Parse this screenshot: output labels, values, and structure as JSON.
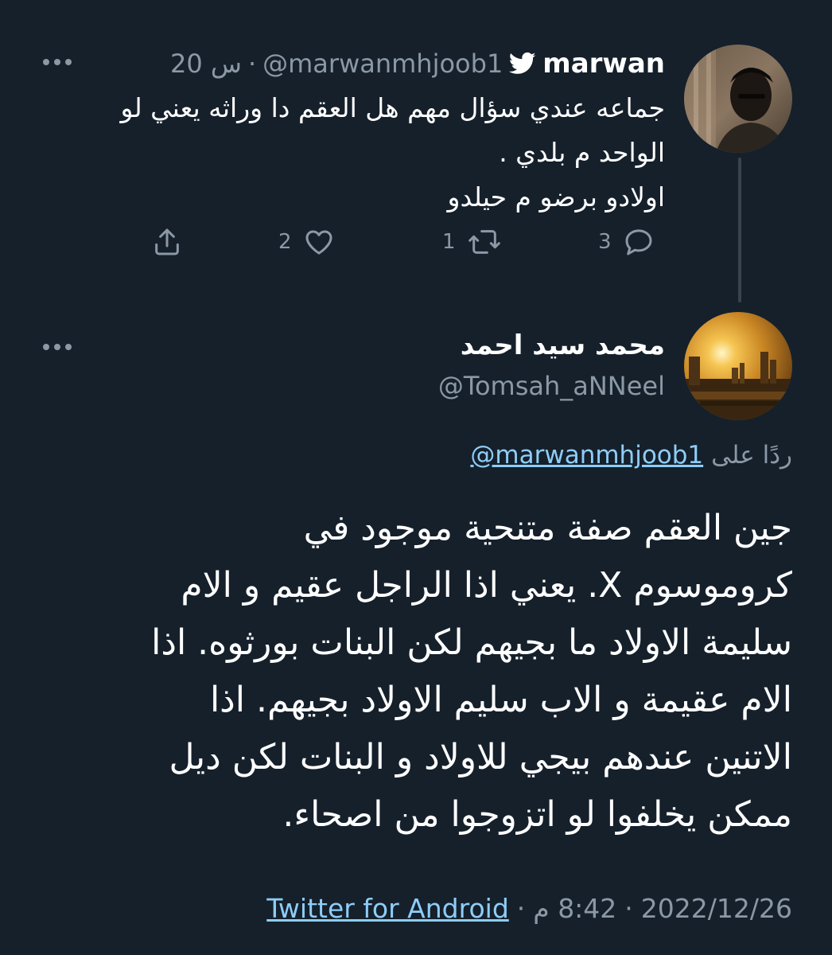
{
  "parent_tweet": {
    "display_name": "marwan",
    "handle": "@marwanmhjoob1",
    "separator": "·",
    "time_ago": "20 س",
    "text_lines": [
      "جماعه عندي سؤال مهم  هل العقم دا وراثه يعني لو",
      "الواحد م بلدي .",
      "اولادو برضو م حيلدو"
    ],
    "actions": {
      "reply_count": "3",
      "retweet_count": "1",
      "like_count": "2"
    }
  },
  "reply_tweet": {
    "display_name": "محمد سيد احمد",
    "handle": "@Tomsah_aNNeel",
    "replying_to_label": "ردًا على",
    "replying_to_handle": "@marwanmhjoob1",
    "text_lines": [
      "جين العقم صفة متنحية  موجود في",
      "كروموسوم  X. يعني اذا الراجل عقيم و الام",
      "سليمة الاولاد ما بجيهم لكن البنات بورثوه. اذا",
      "الام عقيمة و الاب سليم الاولاد بجيهم. اذا",
      "الاتنين عندهم بيجي للاولاد و البنات لكن ديل",
      "ممكن يخلفوا لو اتزوجوا من اصحاء."
    ],
    "date": "2022/12/26",
    "separator": "·",
    "time": "8:42 م",
    "source": "Twitter for Android"
  },
  "icons": {
    "more": "more-horizontal-icon",
    "verified_bird": "twitter-bird-icon",
    "reply": "reply-bubble-icon",
    "retweet": "retweet-icon",
    "like": "heart-icon",
    "share": "share-icon"
  },
  "colors": {
    "background": "#15202b",
    "secondary_text": "#8b98a5",
    "link": "#8ecdf8",
    "thread_line": "#38444d"
  }
}
